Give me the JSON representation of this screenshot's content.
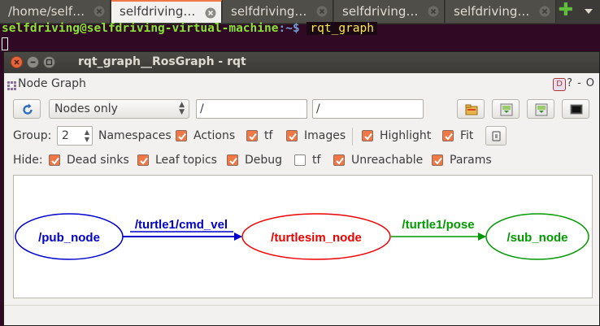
{
  "terminal": {
    "tabs": [
      {
        "label": "/home/self…",
        "active": false
      },
      {
        "label": "selfdriving…",
        "active": true
      },
      {
        "label": "selfdriving…",
        "active": false
      },
      {
        "label": "selfdriving…",
        "active": false
      },
      {
        "label": "selfdriving…",
        "active": false
      }
    ],
    "prompt_user": "selfdriving@selfdriving-virtual-machine",
    "prompt_path": ":~$",
    "command": "rqt_graph"
  },
  "window": {
    "title": "rqt_graph__RosGraph - rqt"
  },
  "plugin": {
    "title": "Node Graph",
    "dock_badge": "D",
    "dock_help": "?",
    "dock_min": "-",
    "dock_close": "O"
  },
  "toolbar": {
    "mode_selected": "Nodes only",
    "node_filter": "/",
    "topic_filter": "/"
  },
  "group_row": {
    "group_label": "Group:",
    "group_value": "2",
    "namespaces_label": "Namespaces",
    "actions_label": "Actions",
    "actions_checked": true,
    "tf_label": "tf",
    "tf_checked": true,
    "images_label": "Images",
    "images_checked": true,
    "highlight_label": "Highlight",
    "highlight_checked": true,
    "fit_label": "Fit",
    "fit_checked": true
  },
  "hide_row": {
    "hide_label": "Hide:",
    "dead_sinks_label": "Dead sinks",
    "dead_sinks_checked": true,
    "leaf_topics_label": "Leaf topics",
    "leaf_topics_checked": true,
    "debug_label": "Debug",
    "debug_checked": true,
    "tf_label": "tf",
    "tf_checked": false,
    "unreachable_label": "Unreachable",
    "unreachable_checked": true,
    "params_label": "Params",
    "params_checked": true
  },
  "graph": {
    "nodes": [
      {
        "name": "/pub_node",
        "color": "#0000cc"
      },
      {
        "name": "/turtlesim_node",
        "color": "#ee0000"
      },
      {
        "name": "/sub_node",
        "color": "#009900"
      }
    ],
    "edges": [
      {
        "label": "/turtle1/cmd_vel",
        "color": "#0000cc"
      },
      {
        "label": "/turtle1/pose",
        "color": "#009900"
      }
    ]
  },
  "colors": {
    "terminal_bg": "#300a24",
    "accent": "#f07746",
    "prompt_green": "#8ae234",
    "prompt_blue": "#729fcf"
  }
}
